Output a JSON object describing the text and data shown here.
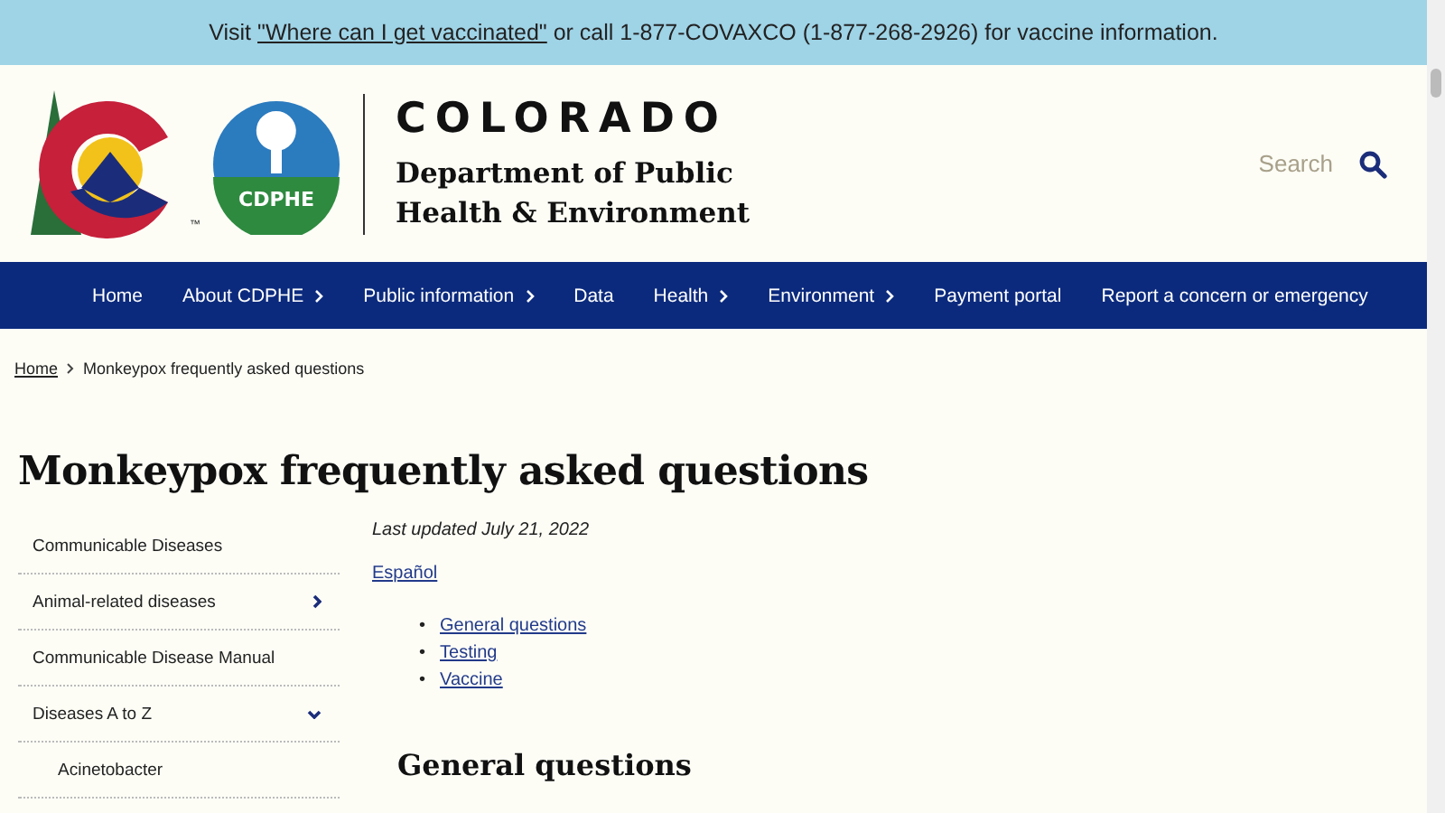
{
  "banner": {
    "before": "Visit ",
    "link": "\"Where can I get vaccinated\"",
    "after": " or call 1-877-COVAXCO (1-877-268-2926) for vaccine information."
  },
  "header": {
    "logo_badge": "CDPHE",
    "trademark": "™",
    "state_name": "COLORADO",
    "department": "Department of Public Health & Environment",
    "search": {
      "placeholder": "Search"
    }
  },
  "nav": [
    {
      "label": "Home",
      "has_submenu": false
    },
    {
      "label": "About CDPHE",
      "has_submenu": true
    },
    {
      "label": "Public information",
      "has_submenu": true
    },
    {
      "label": "Data",
      "has_submenu": false
    },
    {
      "label": "Health",
      "has_submenu": true
    },
    {
      "label": "Environment",
      "has_submenu": true
    },
    {
      "label": "Payment portal",
      "has_submenu": false
    },
    {
      "label": "Report a concern or emergency",
      "has_submenu": false
    }
  ],
  "breadcrumb": [
    {
      "label": "Home",
      "kind": "link"
    },
    {
      "label": "Monkeypox frequently asked questions",
      "kind": "current"
    }
  ],
  "page_title": "Monkeypox frequently asked questions",
  "sidebar": [
    {
      "label": "Communicable Diseases",
      "kind": "link"
    },
    {
      "label": "Animal-related diseases",
      "kind": "expandable",
      "expanded": false
    },
    {
      "label": "Communicable Disease Manual",
      "kind": "link"
    },
    {
      "label": "Diseases A to Z",
      "kind": "expandable",
      "expanded": true,
      "children": [
        {
          "label": "Acinetobacter",
          "kind": "link"
        }
      ]
    }
  ],
  "content": {
    "last_updated": "Last updated July 21, 2022",
    "language_link": "Español",
    "toc": [
      {
        "bullet": "•",
        "label": "General questions"
      },
      {
        "bullet": "•",
        "label": "Testing"
      },
      {
        "bullet": "•",
        "label": "Vaccine"
      }
    ],
    "section_heading": "General questions"
  }
}
